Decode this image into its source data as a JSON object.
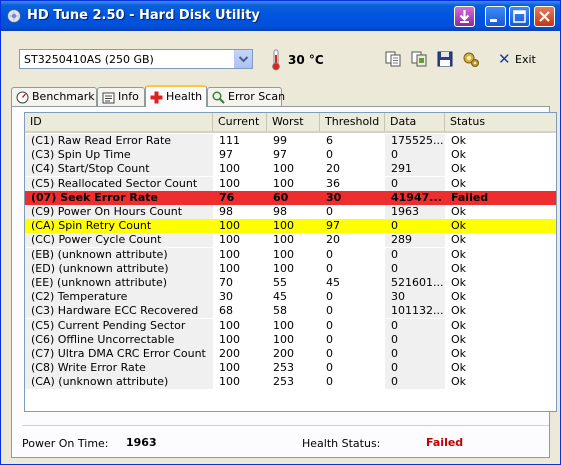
{
  "window": {
    "title": "HD Tune 2.50 - Hard Disk Utility"
  },
  "toolbar": {
    "drive": "ST3250410AS (250 GB)",
    "temperature": "30 °C",
    "exit_label": "Exit"
  },
  "tabs": [
    {
      "label": "Benchmark",
      "icon": "benchmark-icon"
    },
    {
      "label": "Info",
      "icon": "info-icon"
    },
    {
      "label": "Health",
      "icon": "health-icon",
      "active": true
    },
    {
      "label": "Error Scan",
      "icon": "error-scan-icon"
    }
  ],
  "table": {
    "columns": [
      "ID",
      "Current",
      "Worst",
      "Threshold",
      "Data",
      "Status"
    ],
    "rows": [
      {
        "id": "(C1) Raw Read Error Rate",
        "current": "111",
        "worst": "99",
        "threshold": "6",
        "data": "175525...",
        "status": "Ok",
        "state": "normal"
      },
      {
        "id": "(C3) Spin Up Time",
        "current": "97",
        "worst": "97",
        "threshold": "0",
        "data": "0",
        "status": "Ok",
        "state": "normal"
      },
      {
        "id": "(C4) Start/Stop Count",
        "current": "100",
        "worst": "100",
        "threshold": "20",
        "data": "291",
        "status": "Ok",
        "state": "normal"
      },
      {
        "id": "(C5) Reallocated Sector Count",
        "current": "100",
        "worst": "100",
        "threshold": "36",
        "data": "0",
        "status": "Ok",
        "state": "normal"
      },
      {
        "id": "(07) Seek Error Rate",
        "current": "76",
        "worst": "60",
        "threshold": "30",
        "data": "41947...",
        "status": "Failed",
        "state": "failed"
      },
      {
        "id": "(C9) Power On Hours Count",
        "current": "98",
        "worst": "98",
        "threshold": "0",
        "data": "1963",
        "status": "Ok",
        "state": "normal"
      },
      {
        "id": "(CA) Spin Retry Count",
        "current": "100",
        "worst": "100",
        "threshold": "97",
        "data": "0",
        "status": "Ok",
        "state": "warning"
      },
      {
        "id": "(CC) Power Cycle Count",
        "current": "100",
        "worst": "100",
        "threshold": "20",
        "data": "289",
        "status": "Ok",
        "state": "normal"
      },
      {
        "id": "(EB) (unknown attribute)",
        "current": "100",
        "worst": "100",
        "threshold": "0",
        "data": "0",
        "status": "Ok",
        "state": "normal"
      },
      {
        "id": "(ED) (unknown attribute)",
        "current": "100",
        "worst": "100",
        "threshold": "0",
        "data": "0",
        "status": "Ok",
        "state": "normal"
      },
      {
        "id": "(EE) (unknown attribute)",
        "current": "70",
        "worst": "55",
        "threshold": "45",
        "data": "521601...",
        "status": "Ok",
        "state": "normal"
      },
      {
        "id": "(C2) Temperature",
        "current": "30",
        "worst": "45",
        "threshold": "0",
        "data": "30",
        "status": "Ok",
        "state": "normal"
      },
      {
        "id": "(C3) Hardware ECC Recovered",
        "current": "68",
        "worst": "58",
        "threshold": "0",
        "data": "101132...",
        "status": "Ok",
        "state": "normal"
      },
      {
        "id": "(C5) Current Pending Sector",
        "current": "100",
        "worst": "100",
        "threshold": "0",
        "data": "0",
        "status": "Ok",
        "state": "normal"
      },
      {
        "id": "(C6) Offline Uncorrectable",
        "current": "100",
        "worst": "100",
        "threshold": "0",
        "data": "0",
        "status": "Ok",
        "state": "normal"
      },
      {
        "id": "(C7) Ultra DMA CRC Error Count",
        "current": "200",
        "worst": "200",
        "threshold": "0",
        "data": "0",
        "status": "Ok",
        "state": "normal"
      },
      {
        "id": "(C8) Write Error Rate",
        "current": "100",
        "worst": "253",
        "threshold": "0",
        "data": "0",
        "status": "Ok",
        "state": "normal"
      },
      {
        "id": "(CA) (unknown attribute)",
        "current": "100",
        "worst": "253",
        "threshold": "0",
        "data": "0",
        "status": "Ok",
        "state": "normal"
      }
    ]
  },
  "footer": {
    "power_on_label": "Power On Time:",
    "power_on_value": "1963",
    "health_label": "Health Status:",
    "health_value": "Failed"
  },
  "colors": {
    "failed_row": "#ee2e2e",
    "warning_row": "#ffff00",
    "failed_text": "#c00000",
    "titlebar": "#0054e3"
  }
}
